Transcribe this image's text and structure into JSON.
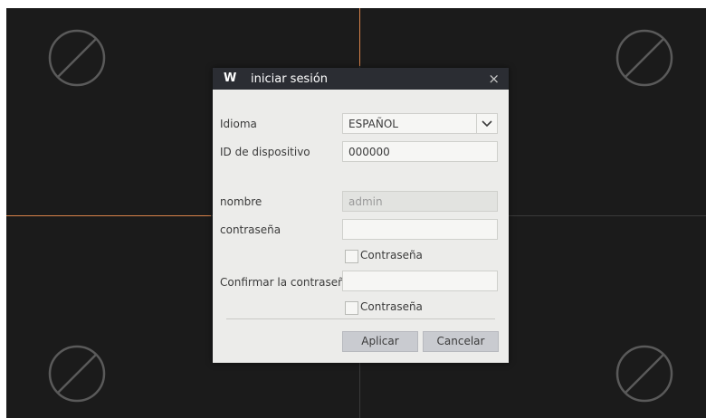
{
  "dialog": {
    "logo": "W",
    "title": "iniciar sesión",
    "close_label": "×"
  },
  "form": {
    "language_label": "Idioma",
    "language_value": "ESPAÑOL",
    "device_id_label": "ID de dispositivo",
    "device_id_value": "000000",
    "name_label": "nombre",
    "name_value": "admin",
    "password_label": "contraseña",
    "password_value": "",
    "show_password_label": "Contraseña",
    "confirm_label": "Confirmar la contraseña",
    "confirm_value": "",
    "show_confirm_label": "Contraseña"
  },
  "buttons": {
    "apply": "Aplicar",
    "cancel": "Cancelar"
  },
  "icons": {
    "no_video": "no-video-icon",
    "dropdown": "chevron-down-icon"
  },
  "colors": {
    "titlebar": "#2b2d33",
    "dialog_bg": "#ececea",
    "highlight_line": "#d9834a"
  }
}
